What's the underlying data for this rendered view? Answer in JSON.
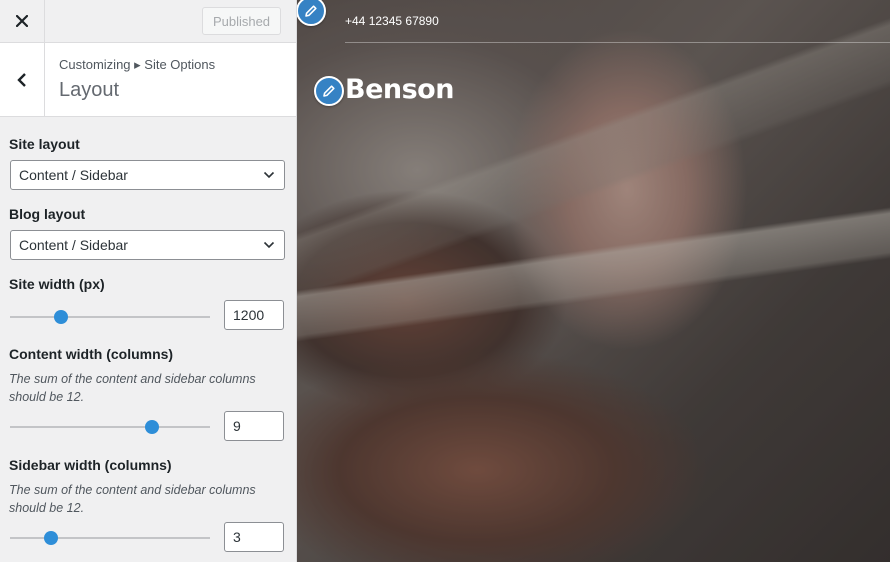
{
  "topbar": {
    "close_icon": "close-icon",
    "published_label": "Published"
  },
  "section": {
    "back_icon": "chevron-left-icon",
    "breadcrumb": "Customizing ▸ Site Options",
    "title": "Layout"
  },
  "controls": {
    "site_layout": {
      "label": "Site layout",
      "value": "Content / Sidebar"
    },
    "blog_layout": {
      "label": "Blog layout",
      "value": "Content / Sidebar"
    },
    "site_width": {
      "label": "Site width (px)",
      "value": "1200"
    },
    "content_width": {
      "label": "Content width (columns)",
      "description": "The sum of the content and sidebar columns should be 12.",
      "value": "9"
    },
    "sidebar_width": {
      "label": "Sidebar width (columns)",
      "description": "The sum of the content and sidebar columns should be 12.",
      "value": "3"
    }
  },
  "preview": {
    "phone": "+44 12345 67890",
    "site_title": "Benson",
    "edit_icon": "pencil-icon"
  },
  "colors": {
    "accent": "#2e8ed8",
    "edit_button": "#3582c4",
    "panel_bg": "#f0f0f1"
  }
}
